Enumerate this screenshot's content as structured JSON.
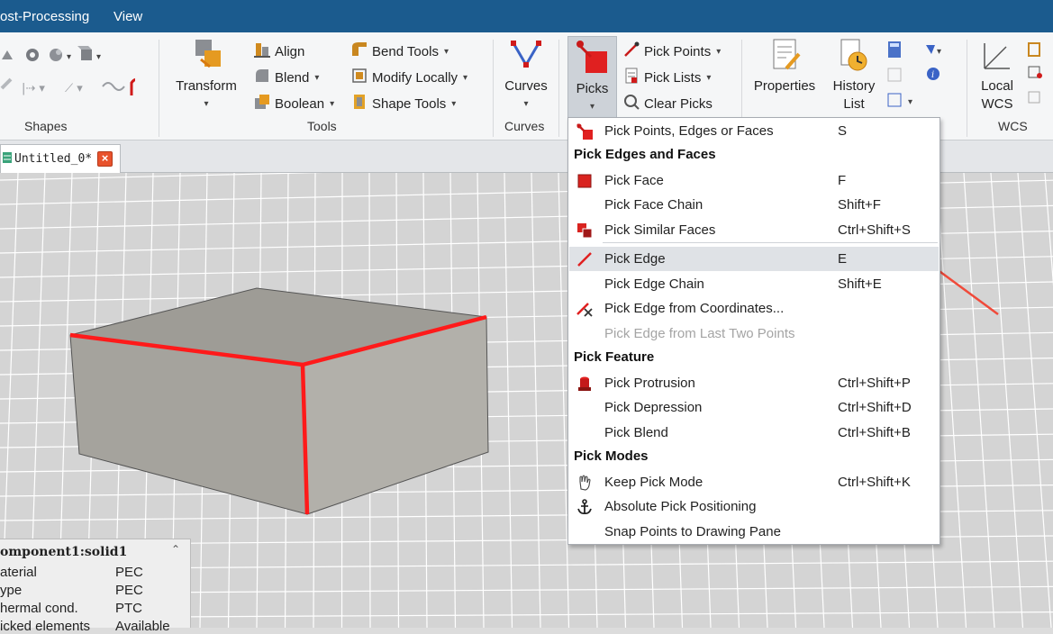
{
  "menubar": {
    "tabs": [
      {
        "label": "ost-Processing"
      },
      {
        "label": "View"
      }
    ]
  },
  "ribbon": {
    "shapes": {
      "group_label": "Shapes"
    },
    "tools": {
      "transform_label": "Transform",
      "align_label": "Align",
      "blend_label": "Blend",
      "boolean_label": "Boolean",
      "bend_tools_label": "Bend Tools",
      "modify_locally_label": "Modify Locally",
      "shape_tools_label": "Shape Tools",
      "group_label": "Tools"
    },
    "curves": {
      "button_label": "Curves",
      "group_label": "Curves"
    },
    "picks": {
      "button_label": "Picks",
      "pick_points_label": "Pick Points",
      "pick_lists_label": "Pick Lists",
      "clear_picks_label": "Clear Picks"
    },
    "edit": {
      "properties_label": "Properties",
      "history_label_1": "History",
      "history_label_2": "List"
    },
    "wcs": {
      "local_label_1": "Local",
      "local_label_2": "WCS",
      "group_label": "WCS"
    }
  },
  "document_tab": {
    "title": "Untitled_0*",
    "close_glyph": "×"
  },
  "info_panel": {
    "title": "omponent1:solid1",
    "collapse_glyph": "⌃",
    "rows": [
      {
        "label": "aterial",
        "value": "PEC"
      },
      {
        "label": "ype",
        "value": "PEC"
      },
      {
        "label": "hermal cond.",
        "value": "PTC"
      },
      {
        "label": "icked elements",
        "value": "Available"
      }
    ]
  },
  "pick_menu": {
    "items": [
      {
        "kind": "item",
        "icon": "pick-points-edges-faces-icon",
        "label": "Pick Points, Edges or Faces",
        "shortcut": "S"
      },
      {
        "kind": "header",
        "label": "Pick Edges and Faces"
      },
      {
        "kind": "item",
        "icon": "pick-face-icon",
        "label": "Pick Face",
        "shortcut": "F"
      },
      {
        "kind": "item",
        "icon": "",
        "label": "Pick Face Chain",
        "shortcut": "Shift+F"
      },
      {
        "kind": "item",
        "icon": "pick-similar-faces-icon",
        "label": "Pick Similar Faces",
        "shortcut": "Ctrl+Shift+S"
      },
      {
        "kind": "item",
        "icon": "pick-edge-icon",
        "label": "Pick Edge",
        "shortcut": "E",
        "highlighted": true
      },
      {
        "kind": "item",
        "icon": "",
        "label": "Pick Edge Chain",
        "shortcut": "Shift+E"
      },
      {
        "kind": "item",
        "icon": "pick-edge-coordinates-icon",
        "label": "Pick Edge from Coordinates...",
        "shortcut": ""
      },
      {
        "kind": "item",
        "icon": "",
        "label": "Pick Edge from Last Two Points",
        "shortcut": "",
        "disabled": true
      },
      {
        "kind": "header",
        "label": "Pick Feature"
      },
      {
        "kind": "item",
        "icon": "pick-protrusion-icon",
        "label": "Pick Protrusion",
        "shortcut": "Ctrl+Shift+P"
      },
      {
        "kind": "item",
        "icon": "",
        "label": "Pick Depression",
        "shortcut": "Ctrl+Shift+D"
      },
      {
        "kind": "item",
        "icon": "",
        "label": "Pick Blend",
        "shortcut": "Ctrl+Shift+B"
      },
      {
        "kind": "header",
        "label": "Pick Modes"
      },
      {
        "kind": "item",
        "icon": "hand-icon",
        "label": "Keep Pick Mode",
        "shortcut": "Ctrl+Shift+K"
      },
      {
        "kind": "item",
        "icon": "anchor-icon",
        "label": "Absolute Pick Positioning",
        "shortcut": ""
      },
      {
        "kind": "item",
        "icon": "",
        "label": "Snap Points to Drawing Pane",
        "shortcut": ""
      }
    ]
  },
  "colors": {
    "menubar_bg": "#1b5b8e",
    "accent_red": "#e02020",
    "selected_edge": "#ff1a1a",
    "annotation_arrow": "#f04a3a",
    "solid_face": "#a5a39d"
  }
}
